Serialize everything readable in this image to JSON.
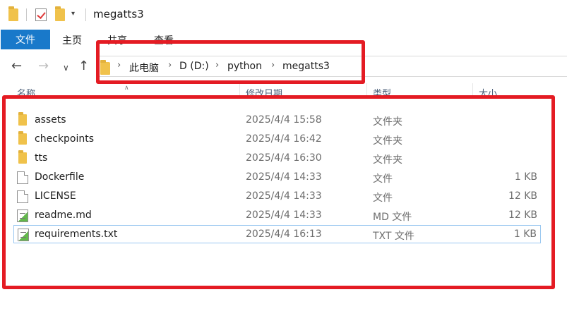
{
  "window": {
    "title": "megatts3"
  },
  "ribbon": {
    "file_tab": "文件",
    "tabs": [
      "主页",
      "共享",
      "查看"
    ]
  },
  "address": {
    "crumbs": [
      "此电脑",
      "D (D:)",
      "python",
      "megatts3"
    ]
  },
  "columns": {
    "name": "名称",
    "modified": "修改日期",
    "type": "类型",
    "size": "大小"
  },
  "files": [
    {
      "name": "assets",
      "modified": "2025/4/4 15:58",
      "type": "文件夹",
      "size": "",
      "icon": "folder-icon"
    },
    {
      "name": "checkpoints",
      "modified": "2025/4/4 16:42",
      "type": "文件夹",
      "size": "",
      "icon": "folder-icon"
    },
    {
      "name": "tts",
      "modified": "2025/4/4 16:30",
      "type": "文件夹",
      "size": "",
      "icon": "folder-icon"
    },
    {
      "name": "Dockerfile",
      "modified": "2025/4/4 14:33",
      "type": "文件",
      "size": "1 KB",
      "icon": "file-icon"
    },
    {
      "name": "LICENSE",
      "modified": "2025/4/4 14:33",
      "type": "文件",
      "size": "12 KB",
      "icon": "file-icon"
    },
    {
      "name": "readme.md",
      "modified": "2025/4/4 14:33",
      "type": "MD 文件",
      "size": "12 KB",
      "icon": "text-file-icon"
    },
    {
      "name": "requirements.txt",
      "modified": "2025/4/4 16:13",
      "type": "TXT 文件",
      "size": "1 KB",
      "icon": "text-file-icon"
    }
  ],
  "theme": {
    "accent": "#1979ca",
    "annotation": "#e41b23",
    "selection_border": "#99c7f0"
  }
}
